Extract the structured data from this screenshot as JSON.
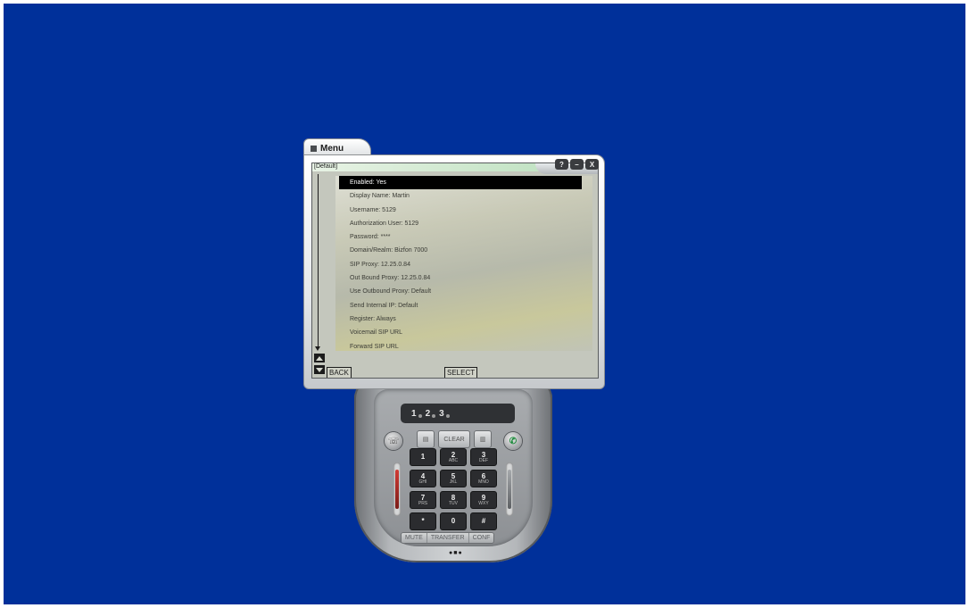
{
  "menu": {
    "title": "Menu",
    "profile": "[Default]",
    "controls": {
      "help": "?",
      "minimize": "–",
      "close": "X"
    },
    "items": [
      "Enabled: Yes",
      "Display Name: Martin",
      "Username: 5129",
      "Authorization User: 5129",
      "Password: ****",
      "Domain/Realm: Bizfon 7000",
      "SIP Proxy: 12.25.0.84",
      "Out Bound Proxy: 12.25.0.84",
      "Use Outbound Proxy: Default",
      "Send Internal IP: Default",
      "Register: Always",
      "Voicemail SIP URL",
      "Forward SIP URL"
    ],
    "selected_index": 0,
    "back_label": "BACK",
    "select_label": "SELECT"
  },
  "phone": {
    "lines": [
      "1",
      "2",
      "3"
    ],
    "clear_label": "CLEAR",
    "keys": [
      {
        "digit": "1",
        "letters": ""
      },
      {
        "digit": "2",
        "letters": "ABC"
      },
      {
        "digit": "3",
        "letters": "DEF"
      },
      {
        "digit": "4",
        "letters": "GHI"
      },
      {
        "digit": "5",
        "letters": "JKL"
      },
      {
        "digit": "6",
        "letters": "MNO"
      },
      {
        "digit": "7",
        "letters": "PRS"
      },
      {
        "digit": "8",
        "letters": "TUV"
      },
      {
        "digit": "9",
        "letters": "WXY"
      },
      {
        "digit": "*",
        "letters": ""
      },
      {
        "digit": "0",
        "letters": ""
      },
      {
        "digit": "#",
        "letters": ""
      }
    ],
    "bottom_buttons": [
      "MUTE",
      "TRANSFER",
      "CONF"
    ],
    "colors": {
      "dial": "#1b8a3a",
      "mic_level": "#d13b34",
      "desktop": "#00309a"
    }
  }
}
